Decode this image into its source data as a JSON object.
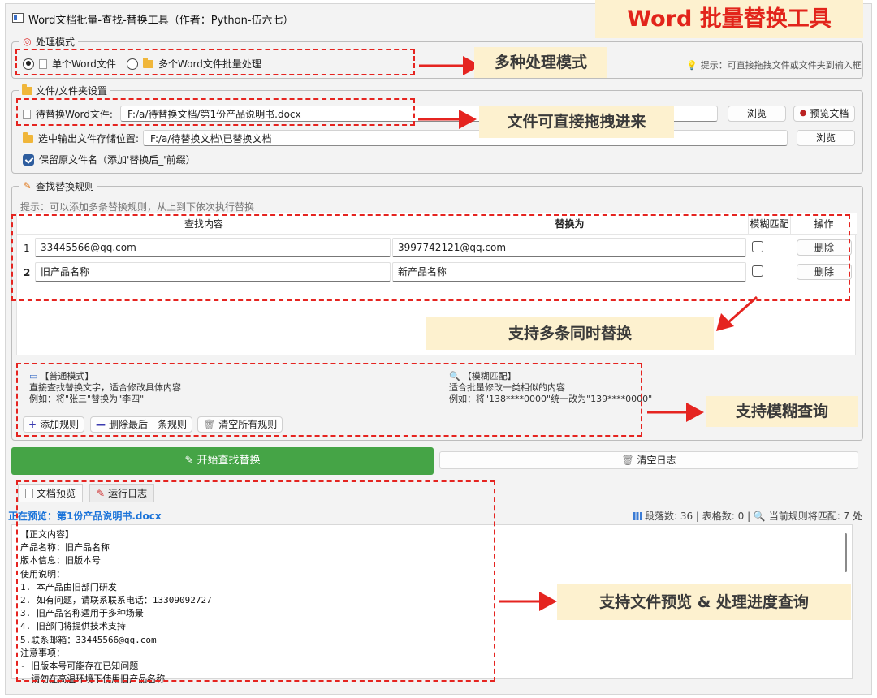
{
  "window": {
    "title": "Word文档批量-查找-替换工具（作者：Python-伍六七）",
    "banner": "Word 批量替换工具"
  },
  "mode_group": {
    "title": "处理模式",
    "option_single": "单个Word文件",
    "option_batch": "多个Word文件批量处理",
    "selected": "单个Word文件",
    "tip": "提示：可直接拖拽文件或文件夹到输入框"
  },
  "file_group": {
    "title": "文件/文件夹设置",
    "source_label": "待替换Word文件:",
    "source_value": "F:/a/待替换文档/第1份产品说明书.docx",
    "browse_label": "浏览",
    "preview_label": "预览文档",
    "output_label": "选中输出文件存储位置:",
    "output_value": "F:/a/待替换文档\\已替换文档",
    "output_browse_label": "浏览",
    "keep_name_label": "保留原文件名（添加'替换后_'前缀）",
    "keep_name_checked": true
  },
  "rules_group": {
    "title": "查找替换规则",
    "hint": "提示：可以添加多条替换规则，从上到下依次执行替换",
    "headers": [
      "查找内容",
      "替换为",
      "模糊匹配",
      "操作"
    ],
    "rows": [
      {
        "num": "1",
        "find": "33445566@qq.com",
        "replace": "3997742121@qq.com",
        "fuzzy": false,
        "action": "删除"
      },
      {
        "num": "2",
        "find": "旧产品名称",
        "replace": "新产品名称",
        "fuzzy": false,
        "action": "删除"
      }
    ],
    "normal_mode": {
      "title": "【普通模式】",
      "line1": "直接查找替换文字，适合修改具体内容",
      "line2": "例如：将\"张三\"替换为\"李四\""
    },
    "fuzzy_mode": {
      "title": "【模糊匹配】",
      "line1": "适合批量修改一类相似的内容",
      "line2": "例如：将\"138****0000\"统一改为\"139****0000\""
    },
    "add_rule": "添加规则",
    "delete_last": "删除最后一条规则",
    "clear_all": "清空所有规则"
  },
  "actions": {
    "start": "开始查找替换",
    "clear_log": "清空日志"
  },
  "tabs": [
    "文档预览",
    "运行日志"
  ],
  "preview": {
    "title": "正在预览：第1份产品说明书.docx",
    "stats": "段落数: 36 | 表格数: 0 | 🔍 当前规则将匹配: 7 处",
    "content": "【正文内容】\n产品名称：旧产品名称\n版本信息：旧版本号\n使用说明：\n1. 本产品由旧部门研发\n2. 如有问题，请联系联系电话：13309092727\n3. 旧产品名称适用于多种场景\n4. 旧部门将提供技术支持\n5.联系邮箱：33445566@qq.com\n注意事项：\n- 旧版本号可能存在已知问题\n- 请勿在高温环境下使用旧产品名称"
  },
  "callouts": {
    "modes": "多种处理模式",
    "drag": "文件可直接拖拽进来",
    "multi": "支持多条同时替换",
    "fuzzy": "支持模糊查询",
    "preview": "支持文件预览 & 处理进度查询"
  },
  "colors": {
    "accent_red": "#e52420",
    "callout_bg": "#fdf1cf",
    "start_green": "#45a446",
    "preview_blue": "#1a73d9"
  }
}
